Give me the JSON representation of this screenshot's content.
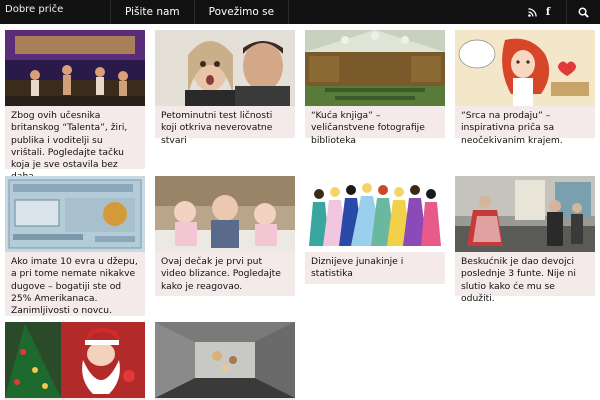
{
  "header": {
    "brand": "Dobre priče",
    "nav": [
      "Pišite nam",
      "Povežimo se"
    ],
    "rss_icon": "rss-icon",
    "facebook_icon": "facebook-icon",
    "facebook_glyph": "f",
    "search_icon": "search-icon"
  },
  "articles": [
    {
      "title": "Zbog ovih učesnika britanskog “Talenta”, žiri, publika i voditelji su vrištali. Pogledajte tačku koja je sve ostavila bez daha."
    },
    {
      "title": "Petominutni test ličnosti koji otkriva neverovatne stvari"
    },
    {
      "title": "“Kuća knjiga” – veličanstvene fotografije biblioteka"
    },
    {
      "title": "“Srca na prodaju” – inspirativna priča sa neočekivanim krajem."
    },
    {
      "title": "Ako imate 10 evra u džepu, a pri tome nemate nikakve dugove – bogatiji ste od 25% Amerikanaca. Zanimljivosti o novcu."
    },
    {
      "title": "Ovaj dečak je prvi put video blizance. Pogledajte kako je reagovao."
    },
    {
      "title": "Diznijeve junakinje i statistika"
    },
    {
      "title": "Beskućnik je dao devojci poslednje 3 funte. Nije ni slutio kako će mu se odužiti."
    },
    {
      "title": ""
    },
    {
      "title": ""
    }
  ]
}
